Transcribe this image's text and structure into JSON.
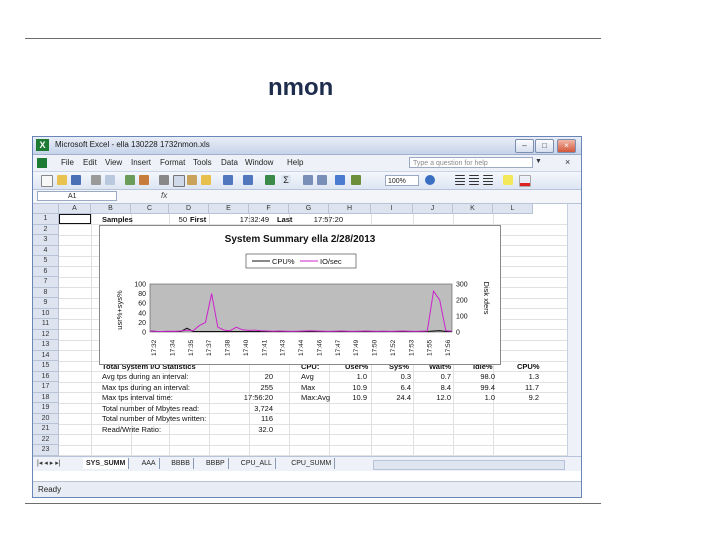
{
  "slide": {
    "title": "nmon"
  },
  "window": {
    "title": "Microsoft Excel - ella 130228 1732nmon.xls",
    "menu": [
      "File",
      "Edit",
      "View",
      "Insert",
      "Format",
      "Tools",
      "Data",
      "Window",
      "Help"
    ],
    "help_placeholder": "Type a question for help",
    "zoom": "100%",
    "name_box": "A1",
    "formula_symbol": "fx",
    "status": "Ready"
  },
  "columns": [
    "A",
    "B",
    "C",
    "D",
    "E",
    "F",
    "G",
    "H",
    "I",
    "J",
    "K",
    "L"
  ],
  "rows": [
    "1",
    "2",
    "3",
    "4",
    "5",
    "6",
    "7",
    "8",
    "9",
    "10",
    "11",
    "12",
    "13",
    "14",
    "15",
    "16",
    "17",
    "18",
    "19",
    "20",
    "21",
    "22",
    "23"
  ],
  "row1": {
    "b": "Samples",
    "c": "50",
    "c2": "First",
    "e": "17:32:49",
    "f": "Last",
    "g": "17:57:20"
  },
  "stats_left": {
    "header": "Total System I/O Statistics",
    "rows": [
      {
        "label": "Avg tps during an interval:",
        "value": "20"
      },
      {
        "label": "Max tps during an interval:",
        "value": "255"
      },
      {
        "label": "Max tps interval time:",
        "value": "17:56:20"
      },
      {
        "label": "Total number of Mbytes read:",
        "value": "3,724"
      },
      {
        "label": "Total number of Mbytes written:",
        "value": "116"
      },
      {
        "label": "Read/Write Ratio:",
        "value": "32.0"
      }
    ]
  },
  "stats_right": {
    "headers": [
      "CPU:",
      "User%",
      "Sys%",
      "Wait%",
      "Idle%",
      "CPU%"
    ],
    "rows": [
      [
        "Avg",
        "1.0",
        "0.3",
        "0.7",
        "98.0",
        "1.3"
      ],
      [
        "Max",
        "10.9",
        "6.4",
        "8.4",
        "99.4",
        "11.7"
      ],
      [
        "Max:Avg",
        "10.9",
        "24.4",
        "12.0",
        "1.0",
        "9.2"
      ]
    ]
  },
  "sheet_tabs": [
    "SYS_SUMM",
    "AAA",
    "BBBB",
    "BBBP",
    "CPU_ALL",
    "CPU_SUMM"
  ],
  "tab_nav": "|◂ ◂ ▸ ▸|",
  "chart_data": {
    "type": "line",
    "title": "System Summary ella  2/28/2013",
    "ylabel": "usr%+sys%",
    "y2label": "Disk xfers",
    "ylim": [
      0,
      100
    ],
    "y2lim": [
      0,
      300
    ],
    "yticks": [
      "0",
      "20",
      "40",
      "60",
      "80",
      "100"
    ],
    "y2ticks": [
      "0",
      "100",
      "200",
      "300"
    ],
    "x": [
      "17:32",
      "17:34",
      "17:35",
      "17:37",
      "17:38",
      "17:40",
      "17:41",
      "17:43",
      "17:44",
      "17:46",
      "17:47",
      "17:49",
      "17:50",
      "17:52",
      "17:53",
      "17:55",
      "17:56"
    ],
    "grid": false,
    "legend_position": "top",
    "series": [
      {
        "name": "CPU%",
        "axis": "left",
        "color": "#111111",
        "values": [
          2,
          1,
          1,
          1,
          1,
          1,
          8,
          1,
          1,
          1,
          1,
          1,
          1,
          1,
          1,
          1,
          1,
          1,
          1,
          1,
          1,
          1,
          1,
          1,
          1,
          1,
          1,
          1,
          1,
          1,
          1,
          1,
          1,
          1,
          1,
          1,
          1,
          1,
          1,
          1,
          1,
          1,
          1,
          1,
          1,
          1,
          2,
          3,
          1,
          1
        ]
      },
      {
        "name": "IO/sec",
        "axis": "right",
        "color": "#cc22cc",
        "values": [
          6,
          4,
          3,
          5,
          4,
          6,
          12,
          8,
          40,
          60,
          240,
          30,
          12,
          8,
          30,
          14,
          10,
          12,
          8,
          6,
          5,
          6,
          5,
          4,
          5,
          6,
          8,
          6,
          5,
          4,
          5,
          6,
          5,
          4,
          5,
          6,
          5,
          4,
          5,
          4,
          5,
          6,
          5,
          4,
          5,
          6,
          255,
          200,
          8,
          5
        ]
      }
    ]
  }
}
